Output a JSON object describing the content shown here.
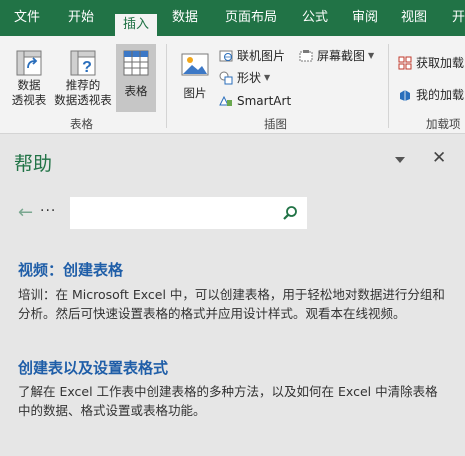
{
  "tabs": [
    {
      "label": "文件"
    },
    {
      "label": "开始"
    },
    {
      "label": "插入"
    },
    {
      "label": "数据"
    },
    {
      "label": "页面布局"
    },
    {
      "label": "公式"
    },
    {
      "label": "审阅"
    },
    {
      "label": "视图"
    },
    {
      "label": "开"
    }
  ],
  "ribbon": {
    "tables_group": {
      "label": "表格",
      "pivot_line1": "数据",
      "pivot_line2": "透视表",
      "recommended_line1": "推荐的",
      "recommended_line2": "数据透视表",
      "table": "表格"
    },
    "illustrations_group": {
      "label": "插图",
      "picture": "图片",
      "online_picture": "联机图片",
      "shapes": "形状",
      "screenshot": "屏幕截图",
      "smartart": "SmartArt"
    },
    "addins_group": {
      "label": "加载项",
      "get_addins": "获取加载",
      "my_addins": "我的加载"
    }
  },
  "help": {
    "title": "帮助",
    "close_glyph": "✕",
    "back_glyph": "←",
    "more_glyph": "···",
    "search_value": "",
    "results": [
      {
        "title": "视频：创建表格",
        "desc": "培训：在 Microsoft Excel 中，可以创建表格，用于轻松地对数据进行分组和分析。然后可快速设置表格的格式并应用设计样式。观看本在线视频。"
      },
      {
        "title": "创建表以及设置表格式",
        "desc": "了解在 Excel 工作表中创建表格的多种方法，以及如何在 Excel 中清除表格中的数据、格式设置或表格功能。"
      }
    ]
  },
  "colors": {
    "accent": "#217346",
    "link": "#1f5ea8",
    "pane_bg": "#e6e6e6",
    "ribbon_bg": "#f3f3f3"
  }
}
